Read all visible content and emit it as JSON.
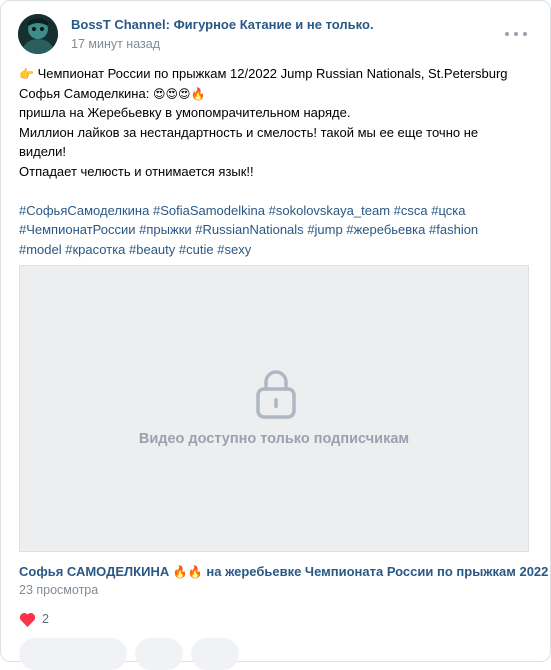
{
  "post": {
    "author": "BossT Channel: Фигурное Катание и не только.",
    "time": "17 минут назад",
    "lines": [
      "Чемпионат России по прыжкам 12/2022 Jump Russian Nationals, St.Petersburg",
      "Софья Самоделкина:",
      "пришла на Жеребьевку в умопомрачительном наряде.",
      "Миллион лайков за нестандартность и смелость! такой мы ее еще точно не",
      "видели!",
      "Отпадает челюсть и отнимается язык!!"
    ],
    "emoji": {
      "point_right": "👉",
      "hearts_eyes": "😍😍😍",
      "fire": "🔥",
      "fire_double": "🔥🔥"
    },
    "hashtags_line1": [
      "#СофьяСамоделкина",
      "#SofiaSamodelkina",
      "#sokolovskaya_team",
      "#csca",
      "#цска"
    ],
    "hashtags_line2": [
      "#ЧемпионатРоссии",
      "#прыжки",
      "#RussianNationals",
      "#jump",
      "#жеребьевка",
      "#fashion"
    ],
    "hashtags_line3": [
      "#model",
      "#красотка",
      "#beauty",
      "#cutie",
      "#sexy"
    ],
    "video": {
      "locked_text": "Видео доступно только подписчикам",
      "title_part1": "Софья САМОДЕЛКИНА",
      "title_part2": "на жеребьевке Чемпионата России по прыжкам 2022",
      "views": "23 просмотра"
    },
    "likes": "2",
    "icons": [
      "more-icon",
      "lock-icon",
      "heart-icon",
      "avatar"
    ],
    "colors": {
      "link": "#2a5885",
      "muted": "#818c99",
      "heart": "#ff3347",
      "placeholder": "#edeef0"
    }
  }
}
